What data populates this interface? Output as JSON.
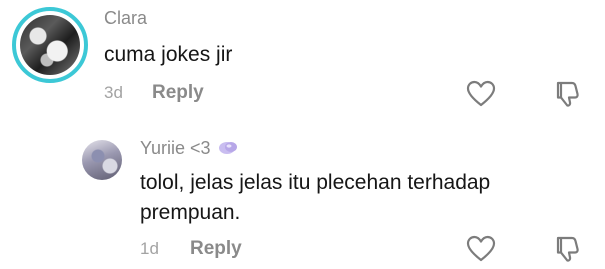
{
  "comments": [
    {
      "username": "Clara",
      "text": "cuma jokes jir",
      "time": "3d",
      "reply_label": "Reply"
    },
    {
      "username": "Yuriie <3",
      "text_line1": "tolol, jelas jelas itu plecehan terhadap",
      "text_line2": "prempuan.",
      "time": "1d",
      "reply_label": "Reply"
    }
  ],
  "icons": {
    "like": "heart-outline-icon",
    "dislike": "thumbs-down-outline-icon",
    "badge": "purple-bubble-badge"
  },
  "colors": {
    "avatar_ring": "#3cc8d6",
    "username": "#8a8a8a",
    "body": "#161616",
    "badge": "#b7a7e8"
  }
}
